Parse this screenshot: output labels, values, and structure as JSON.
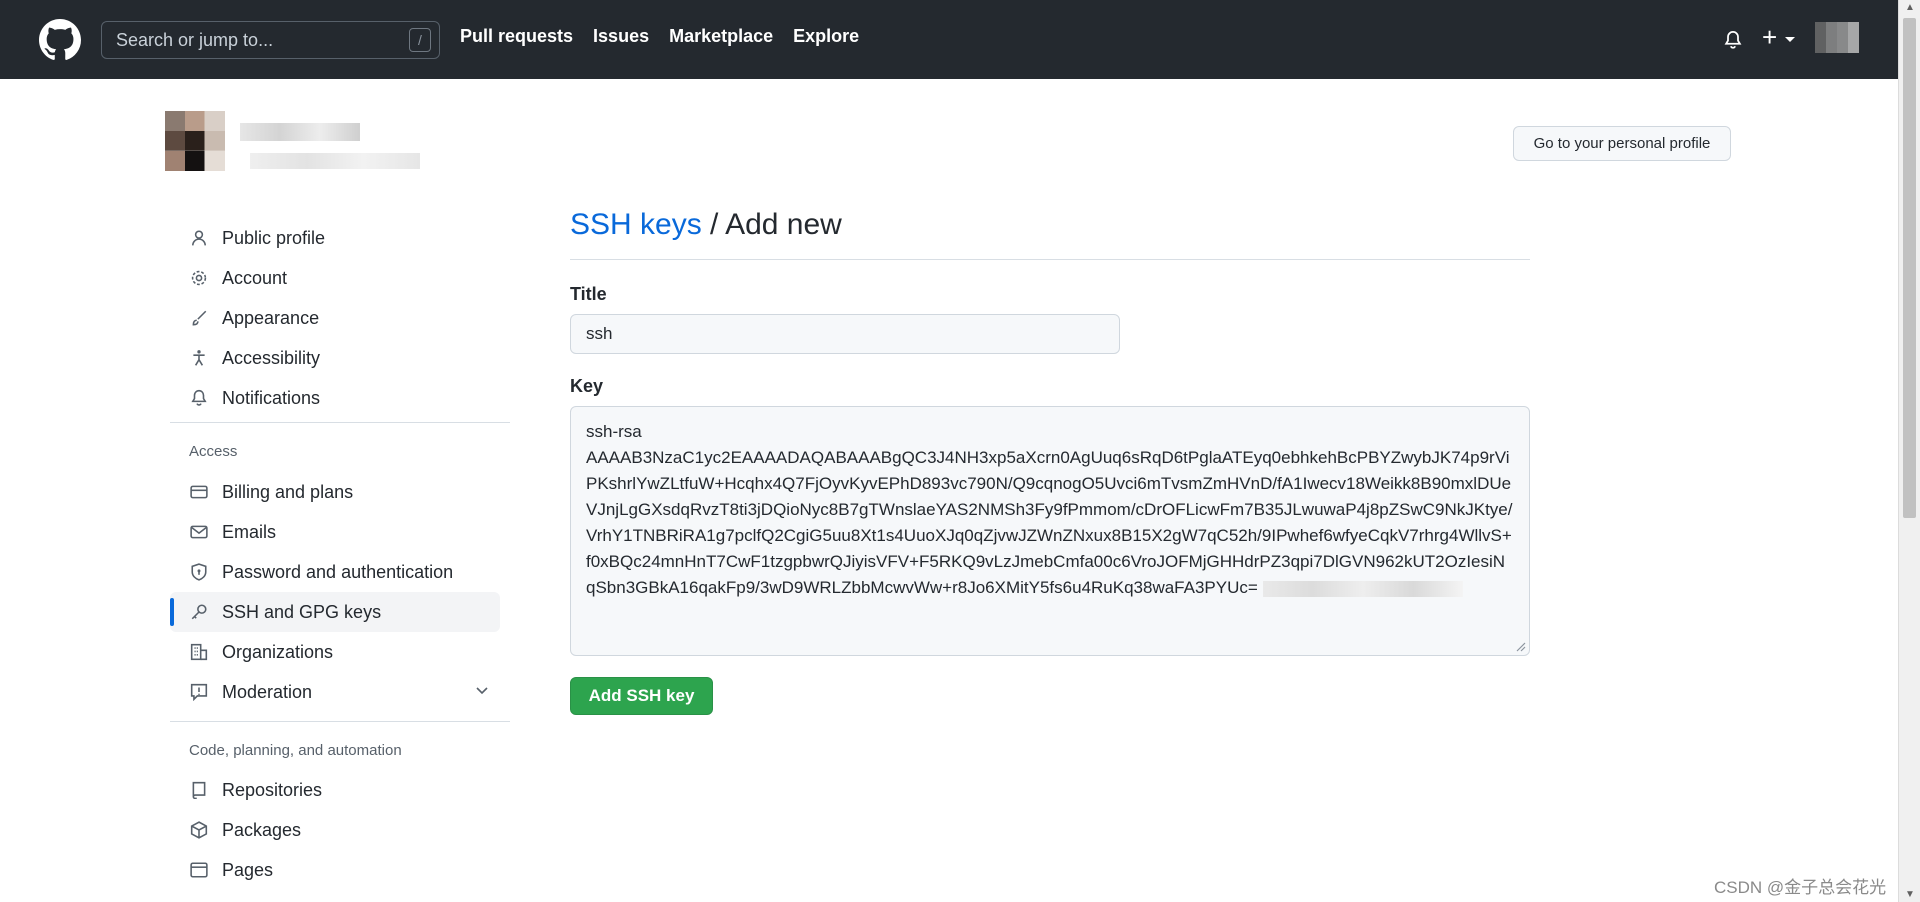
{
  "header": {
    "search_placeholder": "Search or jump to...",
    "search_shortcut": "/",
    "nav": [
      "Pull requests",
      "Issues",
      "Marketplace",
      "Explore"
    ],
    "plus": "+"
  },
  "profile_button": "Go to your personal profile",
  "sidebar": {
    "top_items": [
      "Public profile",
      "Account",
      "Appearance",
      "Accessibility",
      "Notifications"
    ],
    "access_label": "Access",
    "access_items": [
      "Billing and plans",
      "Emails",
      "Password and authentication",
      "SSH and GPG keys",
      "Organizations",
      "Moderation"
    ],
    "code_label": "Code, planning, and automation",
    "code_items": [
      "Repositories",
      "Packages",
      "Pages"
    ],
    "active": "SSH and GPG keys"
  },
  "main": {
    "title_link": "SSH keys",
    "title_rest": " / Add new",
    "title_label": "Title",
    "title_value": "ssh",
    "key_label": "Key",
    "key_value": "ssh-rsa\nAAAAB3NzaC1yc2EAAAADAQABAAABgQC3J4NH3xp5aXcrn0AgUuq6sRqD6tPglaATEyq0ebhkehBcPBYZwybJK74p9rViPKshrlYwZLtfuW+Hcqhx4Q7FjOyvKyvEPhD893vc790N/Q9cqnogO5Uvci6mTvsmZmHVnD/fA1Iwecv18Weikk8B90mxlDUeVJnjLgGXsdqRvzT8ti3jDQioNyc8B7gTWnslaeYAS2NMSh3Fy9fPmmom/cDrOFLicwFm7B35JLwuwaP4j8pZSwC9NkJKtye/VrhY1TNBRiRA1g7pclfQ2CgiG5uu8Xt1s4UuoXJq0qZjvwJZWnZNxux8B15X2gW7qC52h/9IPwhef6wfyeCqkV7rhrg4WllvS+f0xBQc24mnHnT7CwF1tzgpbwrQJiyisVFV+F5RKQ9vLzJmebCmfa00c6VroJOFMjGHHdrPZ3qpi7DlGVN962kUT2OzIesiNqSbn3GBkA16qakFp9/3wD9WRLZbbMcwvWw+r8Jo6XMitY5fs6u4RuKq38waFA3PYUc= ",
    "add_button": "Add SSH key"
  },
  "watermark": "CSDN @金子总会花光",
  "colors": {
    "header_bg": "#24292f",
    "link": "#0969da",
    "primary_button": "#2da44e"
  }
}
